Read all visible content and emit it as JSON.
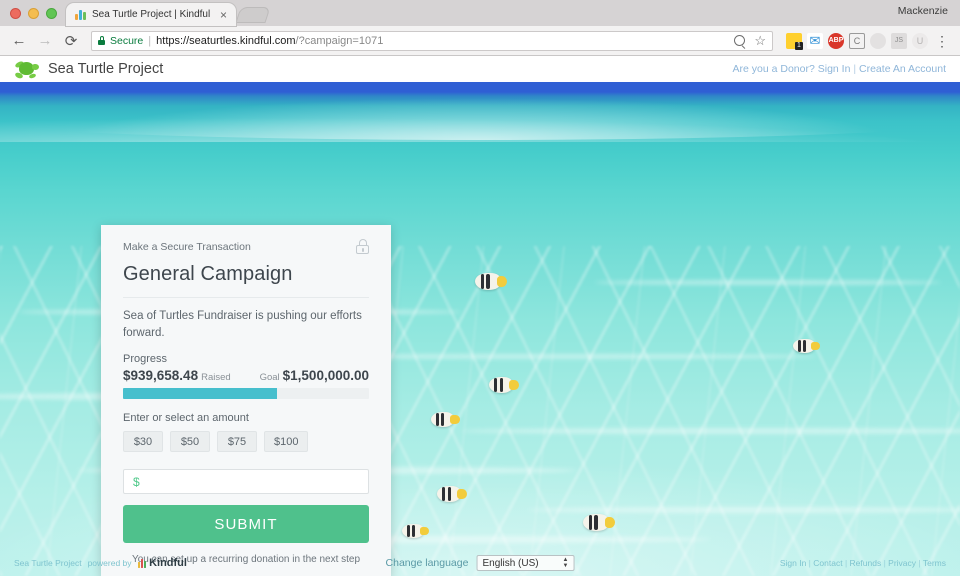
{
  "browser": {
    "tab": {
      "title": "Sea Turtle Project | Kindful",
      "close_label": "×"
    },
    "profile": "Mackenzie",
    "back_icon": "←",
    "forward_icon": "→",
    "reload_icon": "⟳",
    "security_label": "Secure",
    "separator": "|",
    "url_scheme_host": "https://seaturtles.kindful.com",
    "url_path": "/?campaign=1071",
    "bookmark_icon": "☆",
    "menu_icon": "⋮",
    "extensions": [
      {
        "name": "notes-extension-icon",
        "glyph": ""
      },
      {
        "name": "mail-extension-icon",
        "glyph": "✉"
      },
      {
        "name": "adblock-extension-icon",
        "glyph": "ABP"
      },
      {
        "name": "clipboard-extension-icon",
        "glyph": "C"
      },
      {
        "name": "globe-extension-icon",
        "glyph": "◌"
      },
      {
        "name": "js-extension-icon",
        "glyph": "JS"
      },
      {
        "name": "user-extension-icon",
        "glyph": "U"
      }
    ]
  },
  "site_header": {
    "brand": "Sea Turtle Project",
    "donor_prompt": "Are you a Donor?",
    "sign_in": "Sign In",
    "separator": "|",
    "create_account": "Create An Account"
  },
  "card": {
    "secure_label": "Make a Secure Transaction",
    "title": "General Campaign",
    "description": "Sea of Turtles Fundraiser is pushing our efforts forward.",
    "progress_label": "Progress",
    "raised_amount": "$939,658.48",
    "raised_suffix": "Raised",
    "goal_prefix": "Goal",
    "goal_amount": "$1,500,000.00",
    "progress_percent": 62.6,
    "amount_label": "Enter or select an amount",
    "amount_options": [
      "$30",
      "$50",
      "$75",
      "$100"
    ],
    "amount_input_value": "$",
    "amount_input_placeholder": "$",
    "submit_label": "SUBMIT",
    "note": "You can set up a recurring donation in the next step"
  },
  "footer": {
    "site_name": "Sea Turtle Project",
    "powered_by": "powered by",
    "kindful_name": "Kindful",
    "language_label": "Change language",
    "language_value": "English (US)",
    "links": [
      "Sign In",
      "Contact",
      "Refunds",
      "Privacy",
      "Terms"
    ],
    "link_separator": "|"
  },
  "colors": {
    "accent_green": "#4fc18c",
    "progress_teal": "#47bfcd",
    "link_blue": "#8fb6d9",
    "secure_green": "#0a7c3e"
  }
}
